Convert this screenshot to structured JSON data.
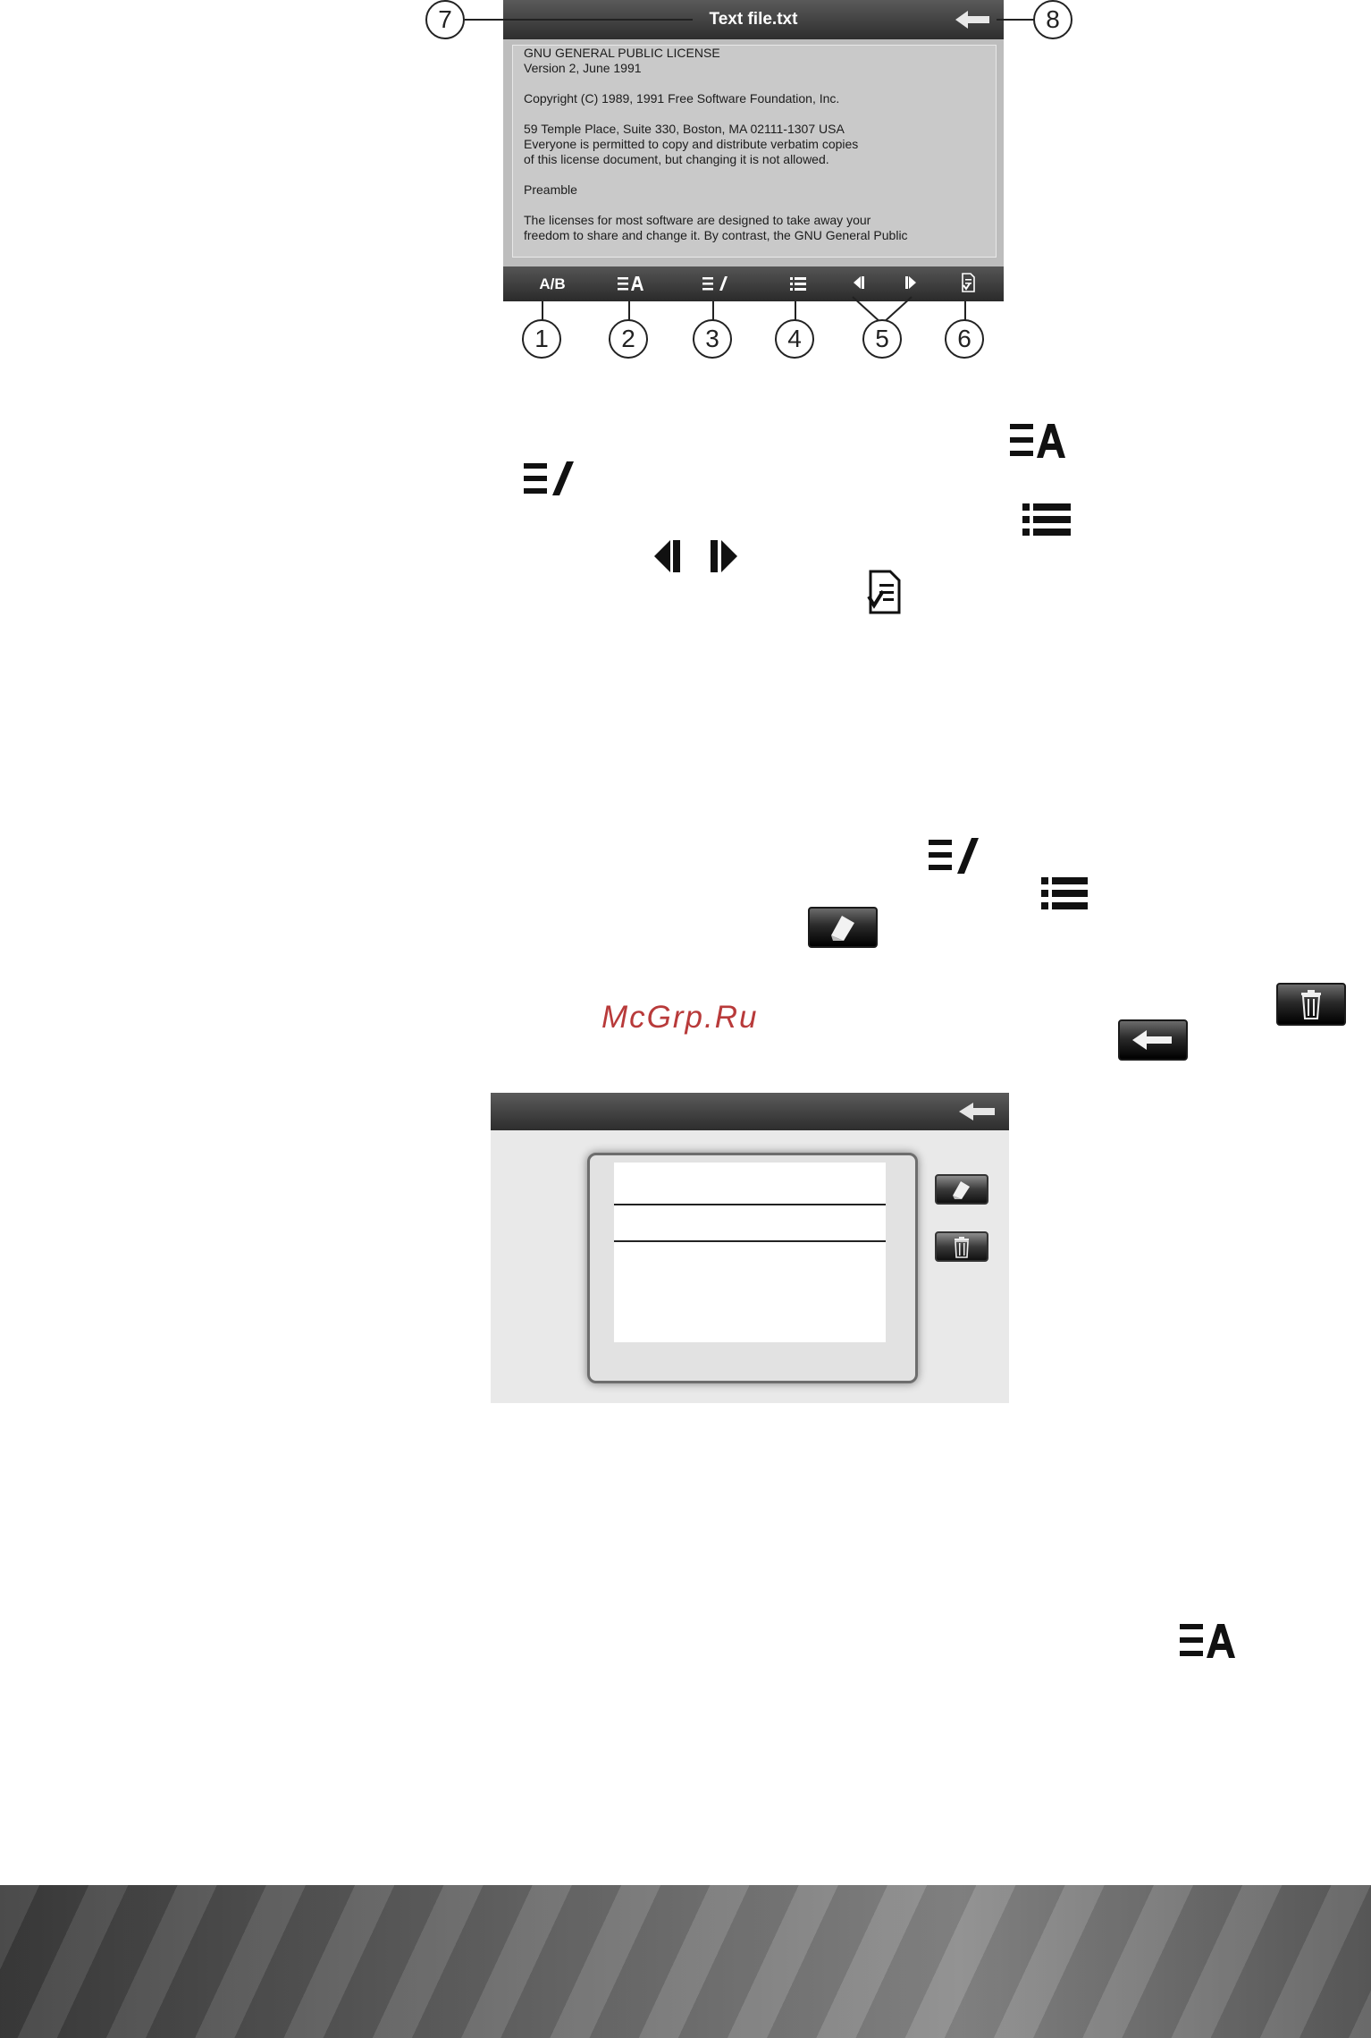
{
  "viewer": {
    "title": "Text file.txt",
    "document_lines": [
      "GNU GENERAL PUBLIC LICENSE",
      "Version 2, June 1991",
      "",
      "Copyright (C) 1989, 1991 Free Software Foundation, Inc.",
      "",
      "59 Temple Place, Suite 330, Boston, MA 02111-1307 USA",
      "Everyone is permitted to copy and distribute verbatim copies",
      "of this license document, but changing it is not allowed.",
      "",
      "Preamble",
      "",
      "The licenses for most software are designed to take away your",
      "freedom to share and change it. By contrast, the GNU General Public"
    ],
    "toolbar": {
      "ab_label": "A/B",
      "font_icon": "text-size-icon",
      "bookmark_add_icon": "bookmark-add-icon",
      "bookmark_list_icon": "list-icon",
      "prev_icon": "previous-page-icon",
      "next_icon": "next-page-icon",
      "options_icon": "document-settings-icon"
    },
    "back_icon": "back-arrow-icon"
  },
  "callouts": {
    "c1": "1",
    "c2": "2",
    "c3": "3",
    "c4": "4",
    "c5": "5",
    "c6": "6",
    "c7": "7",
    "c8": "8"
  },
  "watermark": "McGrp.Ru",
  "bookmark_screen": {
    "back_icon": "back-arrow-icon",
    "edit_icon": "edit-icon",
    "delete_icon": "trash-icon",
    "rows": 3
  }
}
